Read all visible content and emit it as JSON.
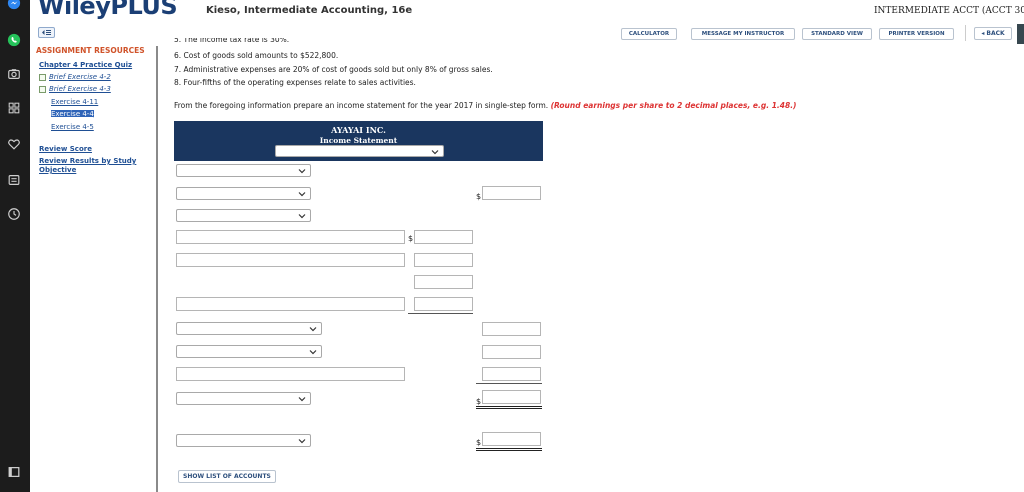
{
  "header": {
    "logo": "WileyPLUS",
    "book": "Kieso, Intermediate Accounting, 16e",
    "course": "INTERMEDIATE ACCT (ACCT 30"
  },
  "toolbar": {
    "calculator": "CALCULATOR",
    "message": "MESSAGE MY INSTRUCTOR",
    "standard": "STANDARD VIEW",
    "printer": "PRINTER VERSION",
    "back": "◂ BACK"
  },
  "sidebar": {
    "heading": "ASSIGNMENT RESOURCES",
    "chapter_quiz": "Chapter 4 Practice Quiz",
    "brief_4_2": "Brief Exercise 4-2",
    "brief_4_3": "Brief Exercise 4-3",
    "ex_4_11": "Exercise 4-11",
    "ex_4_4": "Exercise 4-4",
    "ex_4_5": "Exercise 4-5",
    "review_score": "Review Score",
    "review_results_1": "Review Results by Study",
    "review_results_2": "Objective"
  },
  "problem": {
    "cut_line": "5.  The income tax rate is 30%.",
    "item6": "6.  Cost of goods sold amounts to $522,800.",
    "item7": "7.  Administrative expenses are 20% of cost of goods sold but only 8% of gross sales.",
    "item8": "8.  Four-fifths of the operating expenses relate to sales activities.",
    "instruction": "From the foregoing information prepare an income statement for the year 2017 in single-step form.",
    "instruction_note": "(Round earnings per share to 2 decimal places, e.g. 1.48.)"
  },
  "statement": {
    "company": "AYAYAI INC.",
    "title": "Income Statement",
    "period_selected": "",
    "dollar": "$"
  },
  "buttons": {
    "show_list": "SHOW LIST OF ACCOUNTS"
  },
  "colors": {
    "banner": "#1a365f",
    "accent_link": "#1f4f94",
    "resource_heading": "#d0532a",
    "note_red": "#dd3333"
  },
  "icons": [
    "messenger-icon",
    "whatsapp-icon",
    "camera-icon",
    "apps-grid-icon",
    "heart-icon",
    "feed-icon",
    "clock-icon",
    "window-icon",
    "chevron-down-icon",
    "collapse-sidebar-icon"
  ]
}
